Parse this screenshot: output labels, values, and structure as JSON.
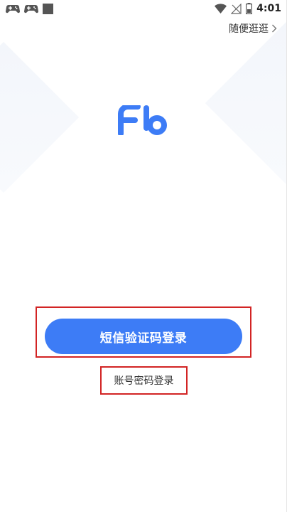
{
  "status_bar": {
    "time": "4:01",
    "left_icons": [
      "gamepad-icon",
      "gamepad-icon",
      "square-notification-icon"
    ],
    "right_icons": [
      "wifi-icon",
      "no-signal-icon",
      "battery-icon"
    ]
  },
  "header": {
    "skip_label": "随便逛逛"
  },
  "logo": {
    "text": "Fb",
    "color": "#3d7cf6"
  },
  "actions": {
    "sms_login_label": "短信验证码登录",
    "password_login_label": "账号密码登录"
  },
  "colors": {
    "primary": "#3d7cf6",
    "highlight": "#d22424"
  }
}
